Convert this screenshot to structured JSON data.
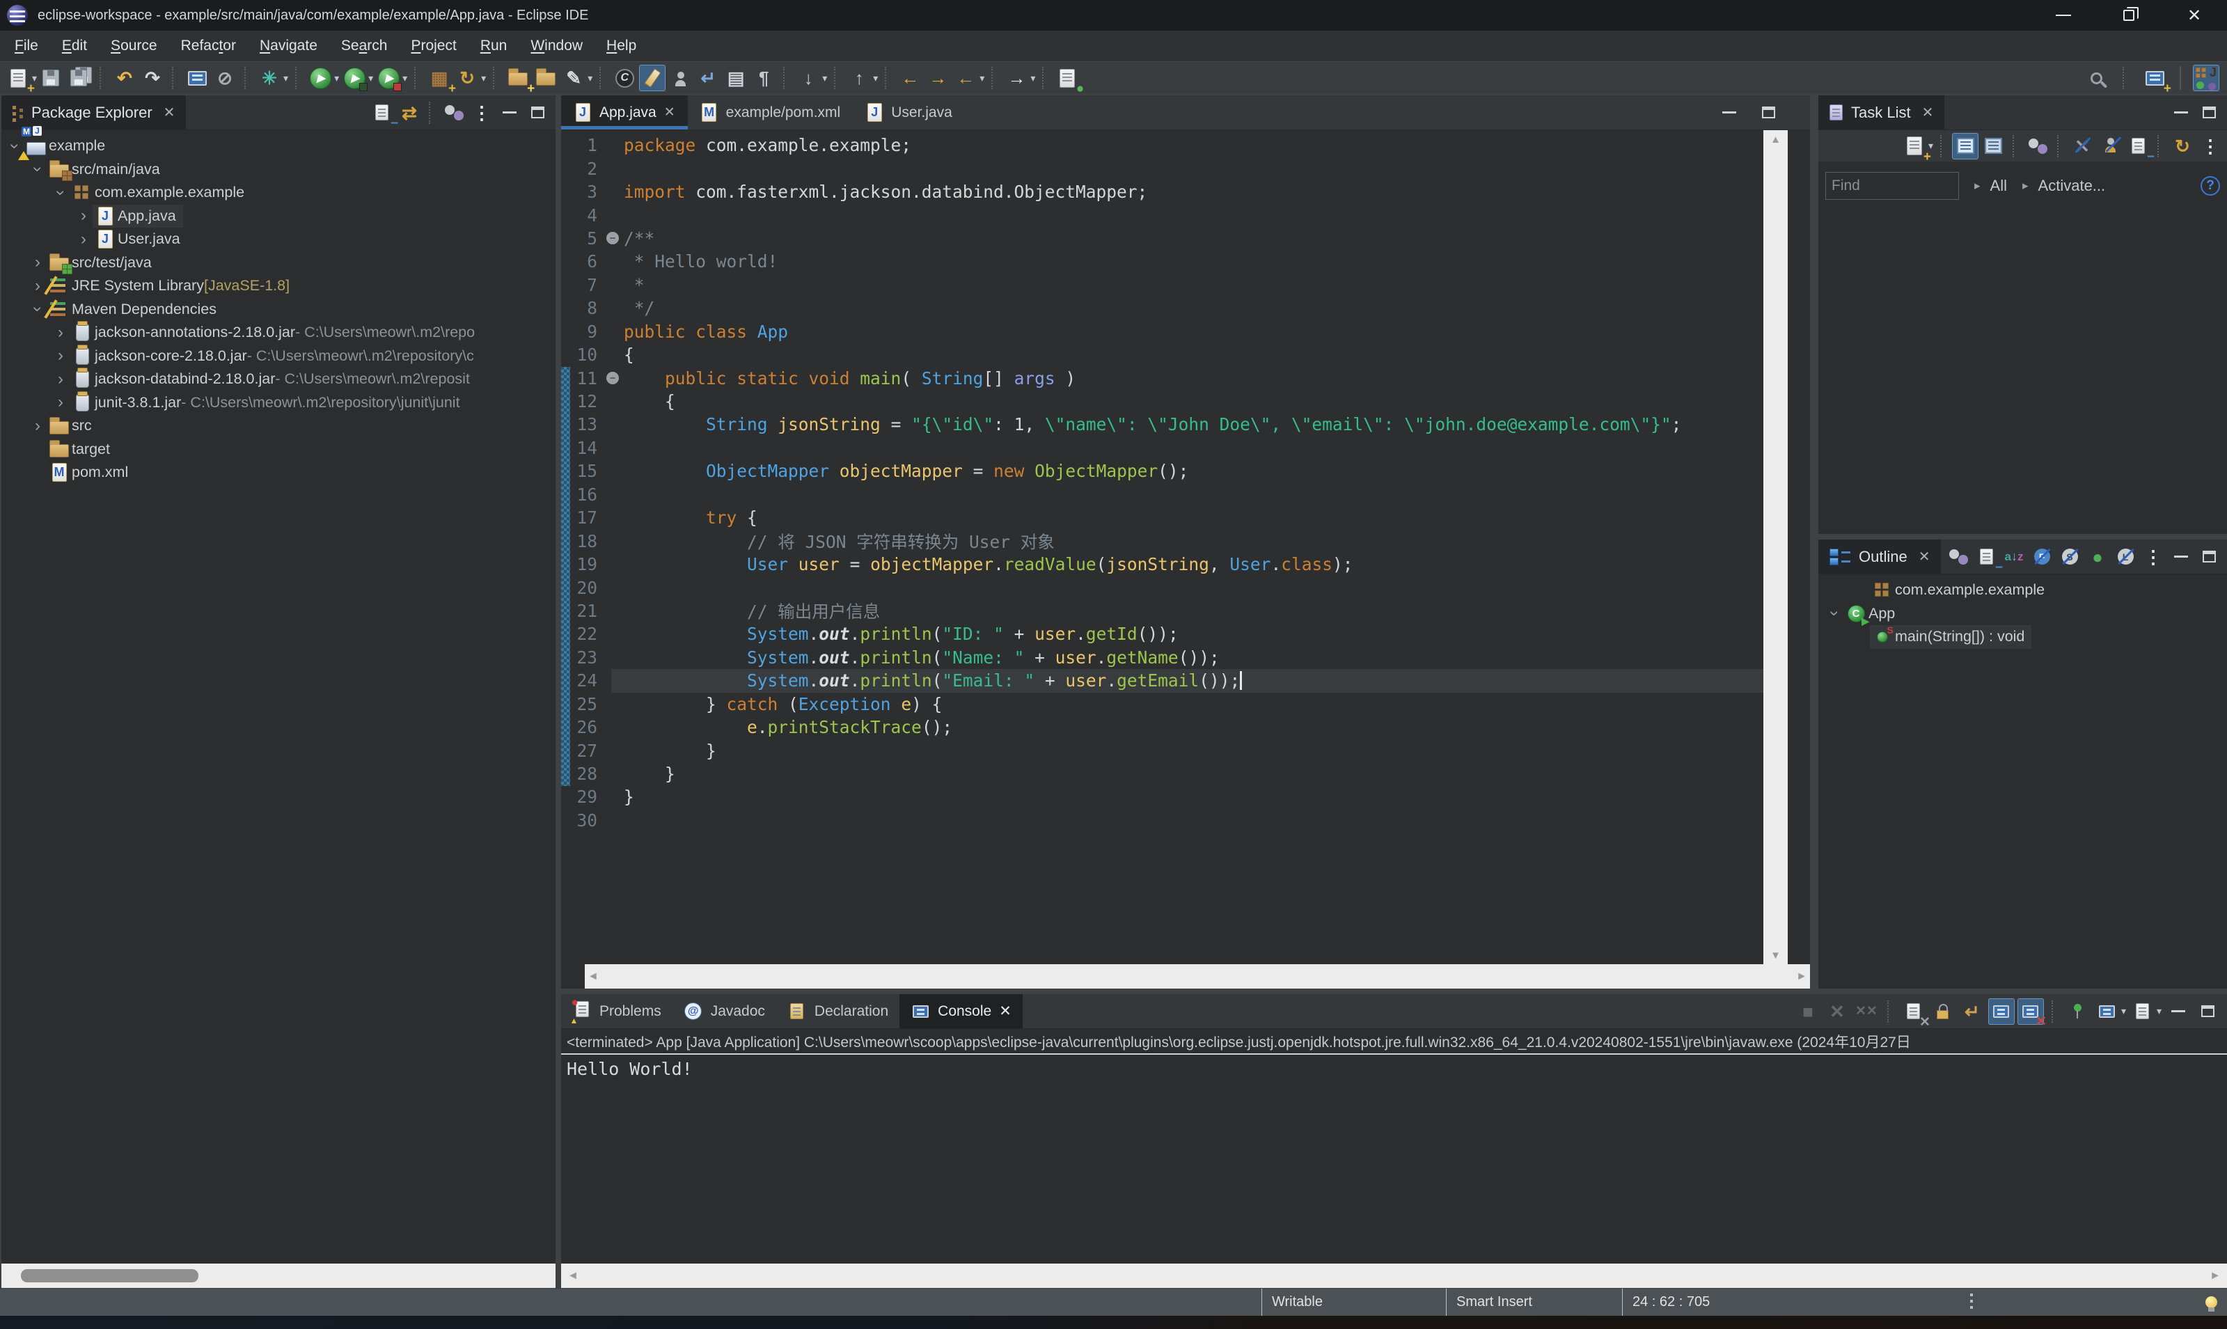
{
  "window": {
    "title": "eclipse-workspace - example/src/main/java/com/example/example/App.java - Eclipse IDE",
    "controls": [
      {
        "name": "minimize"
      },
      {
        "name": "restore"
      },
      {
        "name": "close"
      }
    ]
  },
  "menu_bar": {
    "items": [
      {
        "label": "File",
        "mnemonic": 0
      },
      {
        "label": "Edit",
        "mnemonic": 0
      },
      {
        "label": "Source",
        "mnemonic": 0
      },
      {
        "label": "Refactor",
        "mnemonic": 5
      },
      {
        "label": "Navigate",
        "mnemonic": 0
      },
      {
        "label": "Search",
        "mnemonic": 2
      },
      {
        "label": "Project",
        "mnemonic": 0
      },
      {
        "label": "Run",
        "mnemonic": 0
      },
      {
        "label": "Window",
        "mnemonic": 0
      },
      {
        "label": "Help",
        "mnemonic": 0
      }
    ]
  },
  "main_toolbar": {
    "left": [
      {
        "name": "new-wizard",
        "dropdown": true
      },
      {
        "name": "save"
      },
      {
        "name": "save-all"
      },
      {
        "sep": true
      },
      {
        "name": "undo"
      },
      {
        "name": "redo"
      },
      {
        "sep": true
      },
      {
        "name": "open-new-window"
      },
      {
        "name": "skip-all-breakpoints"
      },
      {
        "sep": true
      },
      {
        "name": "last-edit-location",
        "dropdown": true
      },
      {
        "sep": true
      },
      {
        "name": "run",
        "dropdown": true
      },
      {
        "name": "debug",
        "dropdown": true
      },
      {
        "name": "coverage",
        "dropdown": true
      },
      {
        "sep": true
      },
      {
        "name": "new-junit-test"
      },
      {
        "name": "update-maven-project",
        "dropdown": true
      },
      {
        "sep": true
      },
      {
        "name": "open-type"
      },
      {
        "name": "open-resource"
      },
      {
        "name": "mark-occurrences",
        "dropdown": true
      },
      {
        "sep": true
      },
      {
        "name": "annotation"
      },
      {
        "name": "format",
        "hl": true
      },
      {
        "name": "show-members"
      },
      {
        "name": "next-change"
      },
      {
        "name": "show-view-list"
      },
      {
        "name": "show-whitespace"
      },
      {
        "sep": true
      },
      {
        "name": "next-annotation",
        "dropdown": true
      },
      {
        "sep": true
      },
      {
        "name": "previous-annotation",
        "dropdown": true
      },
      {
        "sep": true
      },
      {
        "name": "back-history"
      },
      {
        "name": "forward-history"
      },
      {
        "name": "back-to-last-edit",
        "dropdown": true
      },
      {
        "sep": true
      },
      {
        "name": "forward",
        "dropdown": true
      },
      {
        "sep": true
      },
      {
        "name": "pin-editor"
      }
    ],
    "right": [
      {
        "name": "search"
      },
      {
        "sep": true
      },
      {
        "name": "open-perspective"
      },
      {
        "vline": true
      },
      {
        "name": "java-perspective",
        "hl": true
      }
    ]
  },
  "package_explorer": {
    "title": "Package Explorer",
    "toolbar": [
      {
        "name": "collapse-all"
      },
      {
        "name": "link-with-editor"
      },
      {
        "sep": true
      },
      {
        "name": "focus"
      },
      {
        "name": "view-menu"
      },
      {
        "name": "minimize"
      },
      {
        "name": "maximize"
      }
    ],
    "tree": [
      {
        "indent": 0,
        "expander": "open",
        "icon": "project",
        "label": "example"
      },
      {
        "indent": 1,
        "expander": "open",
        "icon": "src-folder",
        "label": "src/main/java"
      },
      {
        "indent": 2,
        "expander": "open",
        "icon": "package",
        "label": "com.example.example"
      },
      {
        "indent": 3,
        "expander": "closed",
        "icon": "java-file",
        "label": "App.java",
        "selected": true
      },
      {
        "indent": 3,
        "expander": "closed",
        "icon": "java-file",
        "label": "User.java"
      },
      {
        "indent": 1,
        "expander": "closed",
        "icon": "test-folder",
        "label": "src/test/java"
      },
      {
        "indent": 1,
        "expander": "closed",
        "icon": "library",
        "label": "JRE System Library ",
        "suffix": "[JavaSE-1.8]",
        "suffix_type": "ver"
      },
      {
        "indent": 1,
        "expander": "open",
        "icon": "library",
        "label": "Maven Dependencies"
      },
      {
        "indent": 2,
        "expander": "closed",
        "icon": "jar",
        "label": "jackson-annotations-2.18.0.jar",
        "suffix": " - C:\\Users\\meowr\\.m2\\repo",
        "suffix_type": "path"
      },
      {
        "indent": 2,
        "expander": "closed",
        "icon": "jar",
        "label": "jackson-core-2.18.0.jar",
        "suffix": " - C:\\Users\\meowr\\.m2\\repository\\c",
        "suffix_type": "path"
      },
      {
        "indent": 2,
        "expander": "closed",
        "icon": "jar",
        "label": "jackson-databind-2.18.0.jar",
        "suffix": " - C:\\Users\\meowr\\.m2\\reposit",
        "suffix_type": "path"
      },
      {
        "indent": 2,
        "expander": "closed",
        "icon": "jar",
        "label": "junit-3.8.1.jar",
        "suffix": " - C:\\Users\\meowr\\.m2\\repository\\junit\\junit",
        "suffix_type": "path"
      },
      {
        "indent": 1,
        "expander": "closed",
        "icon": "folder",
        "label": "src"
      },
      {
        "indent": 1,
        "expander": null,
        "icon": "folder",
        "label": "target"
      },
      {
        "indent": 1,
        "expander": null,
        "icon": "xml-file",
        "label": "pom.xml"
      }
    ]
  },
  "editor": {
    "tabs": [
      {
        "icon": "java-file",
        "label": "App.java",
        "active": true,
        "close": true
      },
      {
        "icon": "xml-file",
        "label": "example/pom.xml"
      },
      {
        "icon": "java-file",
        "label": "User.java"
      }
    ],
    "lines": [
      {
        "n": 1,
        "t": [
          [
            "kw",
            "package"
          ],
          [
            "pl",
            " com.example.example;"
          ]
        ]
      },
      {
        "n": 2,
        "t": []
      },
      {
        "n": 3,
        "t": [
          [
            "kw",
            "import"
          ],
          [
            "pl",
            " com.fasterxml.jackson.databind.ObjectMapper;"
          ]
        ]
      },
      {
        "n": 4,
        "t": []
      },
      {
        "n": 5,
        "fold": true,
        "t": [
          [
            "cm",
            "/**"
          ]
        ]
      },
      {
        "n": 6,
        "t": [
          [
            "cm",
            " * Hello world!"
          ]
        ]
      },
      {
        "n": 7,
        "t": [
          [
            "cm",
            " *"
          ]
        ]
      },
      {
        "n": 8,
        "t": [
          [
            "cm",
            " */"
          ]
        ]
      },
      {
        "n": 9,
        "t": [
          [
            "kw",
            "public class"
          ],
          [
            "pl",
            " "
          ],
          [
            "ty",
            "App"
          ]
        ]
      },
      {
        "n": 10,
        "t": [
          [
            "pl",
            "{"
          ]
        ]
      },
      {
        "n": 11,
        "fold": true,
        "t": [
          [
            "pl",
            "    "
          ],
          [
            "kw",
            "public static void"
          ],
          [
            "pl",
            " "
          ],
          [
            "me",
            "main"
          ],
          [
            "pl",
            "( "
          ],
          [
            "ty",
            "String"
          ],
          [
            "pl",
            "[] "
          ],
          [
            "pa",
            "args"
          ],
          [
            "pl",
            " )"
          ]
        ]
      },
      {
        "n": 12,
        "t": [
          [
            "pl",
            "    {"
          ]
        ]
      },
      {
        "n": 13,
        "t": [
          [
            "pl",
            "        "
          ],
          [
            "ty",
            "String"
          ],
          [
            "pl",
            " "
          ],
          [
            "va",
            "jsonString"
          ],
          [
            "pl",
            " = "
          ],
          [
            "st",
            "\"{\\\"id\\\""
          ],
          [
            "pl",
            ": 1, "
          ],
          [
            "st",
            "\\\"name\\\": \\\"John Doe\\\", \\\"email\\\": \\\"john.doe@example.com\\\"}\""
          ],
          [
            "pl",
            ";"
          ]
        ]
      },
      {
        "n": 14,
        "t": []
      },
      {
        "n": 15,
        "t": [
          [
            "pl",
            "        "
          ],
          [
            "ty",
            "ObjectMapper"
          ],
          [
            "pl",
            " "
          ],
          [
            "va",
            "objectMapper"
          ],
          [
            "pl",
            " = "
          ],
          [
            "kw",
            "new"
          ],
          [
            "pl",
            " "
          ],
          [
            "me",
            "ObjectMapper"
          ],
          [
            "pl",
            "();"
          ]
        ]
      },
      {
        "n": 16,
        "t": []
      },
      {
        "n": 17,
        "t": [
          [
            "pl",
            "        "
          ],
          [
            "kw",
            "try"
          ],
          [
            "pl",
            " {"
          ]
        ]
      },
      {
        "n": 18,
        "t": [
          [
            "pl",
            "            "
          ],
          [
            "cm",
            "// 将 JSON 字符串转换为 User 对象"
          ]
        ]
      },
      {
        "n": 19,
        "t": [
          [
            "pl",
            "            "
          ],
          [
            "ty",
            "User"
          ],
          [
            "pl",
            " "
          ],
          [
            "va",
            "user"
          ],
          [
            "pl",
            " = "
          ],
          [
            "va",
            "objectMapper"
          ],
          [
            "pl",
            "."
          ],
          [
            "me",
            "readValue"
          ],
          [
            "pl",
            "("
          ],
          [
            "va",
            "jsonString"
          ],
          [
            "pl",
            ", "
          ],
          [
            "ty",
            "User"
          ],
          [
            "pl",
            "."
          ],
          [
            "kw",
            "class"
          ],
          [
            "pl",
            ");"
          ]
        ]
      },
      {
        "n": 20,
        "t": []
      },
      {
        "n": 21,
        "t": [
          [
            "pl",
            "            "
          ],
          [
            "cm",
            "// 输出用户信息"
          ]
        ]
      },
      {
        "n": 22,
        "t": [
          [
            "pl",
            "            "
          ],
          [
            "ty",
            "System"
          ],
          [
            "pl",
            "."
          ],
          [
            "fi",
            "out"
          ],
          [
            "pl",
            "."
          ],
          [
            "me",
            "println"
          ],
          [
            "pl",
            "("
          ],
          [
            "st",
            "\"ID: \""
          ],
          [
            "pl",
            " + "
          ],
          [
            "va",
            "user"
          ],
          [
            "pl",
            "."
          ],
          [
            "me",
            "getId"
          ],
          [
            "pl",
            "());"
          ]
        ]
      },
      {
        "n": 23,
        "t": [
          [
            "pl",
            "            "
          ],
          [
            "ty",
            "System"
          ],
          [
            "pl",
            "."
          ],
          [
            "fi",
            "out"
          ],
          [
            "pl",
            "."
          ],
          [
            "me",
            "println"
          ],
          [
            "pl",
            "("
          ],
          [
            "st",
            "\"Name: \""
          ],
          [
            "pl",
            " + "
          ],
          [
            "va",
            "user"
          ],
          [
            "pl",
            "."
          ],
          [
            "me",
            "getName"
          ],
          [
            "pl",
            "());"
          ]
        ]
      },
      {
        "n": 24,
        "cur": true,
        "caret": true,
        "t": [
          [
            "pl",
            "            "
          ],
          [
            "ty",
            "System"
          ],
          [
            "pl",
            "."
          ],
          [
            "fi",
            "out"
          ],
          [
            "pl",
            "."
          ],
          [
            "me",
            "println"
          ],
          [
            "pl",
            "("
          ],
          [
            "st",
            "\"Email: \""
          ],
          [
            "pl",
            " + "
          ],
          [
            "va",
            "user"
          ],
          [
            "pl",
            "."
          ],
          [
            "me",
            "getEmail"
          ],
          [
            "pl",
            "());"
          ]
        ]
      },
      {
        "n": 25,
        "t": [
          [
            "pl",
            "        } "
          ],
          [
            "kw",
            "catch"
          ],
          [
            "pl",
            " ("
          ],
          [
            "ty",
            "Exception"
          ],
          [
            "pl",
            " "
          ],
          [
            "va",
            "e"
          ],
          [
            "pl",
            ") {"
          ]
        ]
      },
      {
        "n": 26,
        "t": [
          [
            "pl",
            "            "
          ],
          [
            "va",
            "e"
          ],
          [
            "pl",
            "."
          ],
          [
            "me",
            "printStackTrace"
          ],
          [
            "pl",
            "();"
          ]
        ]
      },
      {
        "n": 27,
        "t": [
          [
            "pl",
            "        }"
          ]
        ]
      },
      {
        "n": 28,
        "t": [
          [
            "pl",
            "    }"
          ]
        ]
      },
      {
        "n": 29,
        "t": [
          [
            "pl",
            "}"
          ]
        ]
      },
      {
        "n": 30,
        "t": []
      }
    ],
    "range_indicator_lines": [
      11,
      28
    ]
  },
  "task_list": {
    "title": "Task List",
    "toolbar": [
      {
        "name": "new-task",
        "dropdown": true
      },
      {
        "sep": true
      },
      {
        "name": "categorized",
        "hl": true
      },
      {
        "name": "scheduled"
      },
      {
        "sep": true
      },
      {
        "name": "focus"
      },
      {
        "sep": true
      },
      {
        "name": "hide-completed"
      },
      {
        "name": "hide-private"
      },
      {
        "name": "collapse-all"
      },
      {
        "sep": true
      },
      {
        "name": "synchronize"
      },
      {
        "name": "view-menu"
      }
    ],
    "find_placeholder": "Find",
    "scope_all": "All",
    "activate_label": "Activate...",
    "help_glyph": "?"
  },
  "outline": {
    "title": "Outline",
    "toolbar": [
      {
        "name": "focus"
      },
      {
        "name": "collapse-all"
      },
      {
        "name": "sort"
      },
      {
        "name": "hide-fields"
      },
      {
        "name": "hide-static"
      },
      {
        "name": "hide-non-public"
      },
      {
        "name": "hide-local-types"
      },
      {
        "name": "view-menu"
      },
      {
        "name": "minimize"
      },
      {
        "name": "maximize"
      }
    ],
    "tree": [
      {
        "indent": 1,
        "expander": null,
        "icon": "package",
        "label": "com.example.example"
      },
      {
        "indent": 0,
        "expander": "open",
        "icon": "class-run",
        "label": "App"
      },
      {
        "indent": 1,
        "expander": null,
        "icon": "method-static",
        "label": "main(String[]) : void",
        "selected": true
      }
    ]
  },
  "console": {
    "tabs": [
      {
        "icon": "problems",
        "label": "Problems"
      },
      {
        "icon": "javadoc",
        "label": "Javadoc"
      },
      {
        "icon": "declaration",
        "label": "Declaration"
      },
      {
        "icon": "console",
        "label": "Console",
        "active": true,
        "close": true
      }
    ],
    "toolbar": [
      {
        "name": "terminate",
        "disabled": true
      },
      {
        "name": "remove-launch",
        "disabled": true
      },
      {
        "name": "remove-all-launches",
        "disabled": true
      },
      {
        "sep": true
      },
      {
        "name": "clear-console"
      },
      {
        "name": "scroll-lock"
      },
      {
        "name": "word-wrap"
      },
      {
        "name": "show-on-stdout",
        "hl": true
      },
      {
        "name": "show-on-stderr",
        "hl": true
      },
      {
        "sep": true
      },
      {
        "name": "pin-console"
      },
      {
        "name": "display-selected-console",
        "dropdown": true
      },
      {
        "name": "open-console",
        "dropdown": true
      },
      {
        "name": "minimize"
      },
      {
        "name": "maximize"
      }
    ],
    "status_line": "<terminated> App [Java Application] C:\\Users\\meowr\\scoop\\apps\\eclipse-java\\current\\plugins\\org.eclipse.justj.openjdk.hotspot.jre.full.win32.x86_64_21.0.4.v20240802-1551\\jre\\bin\\javaw.exe  (2024年10月27日",
    "output": "Hello World!"
  },
  "status_bar": {
    "writable": "Writable",
    "insert_mode": "Smart Insert",
    "position": "24 : 62 : 705"
  },
  "colors": {
    "accent": "#3b76b5",
    "keyword": "#ce8032",
    "type": "#4fa3e0",
    "method": "#9ec54c",
    "variable": "#eac56b",
    "string": "#37bd8c",
    "comment": "#7b8790",
    "selection": "#35383a"
  }
}
